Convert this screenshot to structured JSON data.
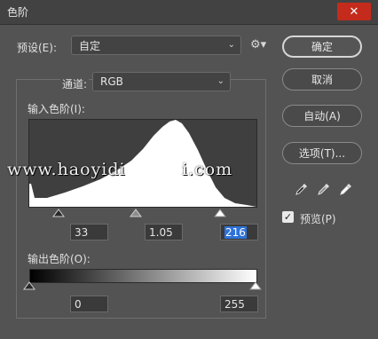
{
  "window": {
    "title": "色阶",
    "close_symbol": "✕"
  },
  "preset": {
    "label": "预设(E):",
    "value": "自定"
  },
  "channel": {
    "label": "通道:",
    "value": "RGB"
  },
  "input_levels": {
    "label": "输入色阶(I):",
    "black": "33",
    "gamma": "1.05",
    "white": "216"
  },
  "output_levels": {
    "label": "输出色阶(O):",
    "black": "0",
    "white": "255"
  },
  "buttons": {
    "ok": "确定",
    "cancel": "取消",
    "auto": "自动(A)",
    "options": "选项(T)..."
  },
  "preview": {
    "label": "预览(P)",
    "checked": true
  },
  "watermark": "www.haoyidi         i.com",
  "icons": {
    "gear": "gear-icon",
    "chevron": "chevron-down-icon",
    "eyedropper_black": "eyedropper-black-icon",
    "eyedropper_gray": "eyedropper-gray-icon",
    "eyedropper_white": "eyedropper-white-icon"
  },
  "colors": {
    "panel": "#535353",
    "titlebar": "#424242",
    "close": "#c42b1c",
    "selection": "#2d72d9"
  }
}
